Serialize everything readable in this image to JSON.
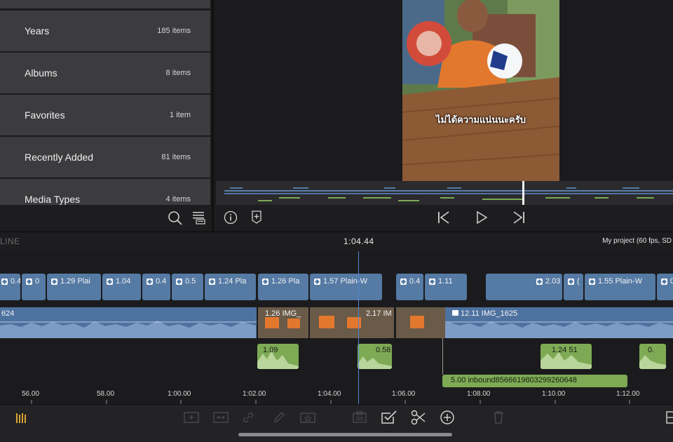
{
  "library": {
    "items": [
      {
        "label": "Years",
        "count": "185 items"
      },
      {
        "label": "Albums",
        "count": "8 items"
      },
      {
        "label": "Favorites",
        "count": "1 item"
      },
      {
        "label": "Recently Added",
        "count": "81 items"
      },
      {
        "label": "Media Types",
        "count": "4 items"
      }
    ]
  },
  "viewer": {
    "subtitle": "ไม่ได้ความแน่นนะครับ"
  },
  "timeline": {
    "mode_label": "LINE",
    "current_time": "1:04.44",
    "project_info": "My project (60 fps, SD",
    "title_clips": [
      {
        "label": "0.4"
      },
      {
        "label": "0"
      },
      {
        "label": "1.29  Plai"
      },
      {
        "label": "1.04"
      },
      {
        "label": "0.4"
      },
      {
        "label": "0.5"
      },
      {
        "label": "1.24  Pla"
      },
      {
        "label": "1.26  Pla"
      },
      {
        "label": "1.57  Plain-W"
      },
      {
        "label": "0.4"
      },
      {
        "label": "1.11"
      },
      {
        "label": "2.03"
      },
      {
        "label": "("
      },
      {
        "label": "1.55  Plain-W"
      },
      {
        "label": "0."
      }
    ],
    "primary_clips": [
      {
        "label": "624"
      },
      {
        "label": "1.26  IMG_"
      },
      {
        "label": "2.17  IM"
      },
      {
        "label": "12.11  IMG_1625"
      }
    ],
    "audio_clips": [
      {
        "label": "1.09"
      },
      {
        "label": "0.58"
      },
      {
        "label": "1.24  51"
      },
      {
        "label": "0."
      },
      {
        "label": "5.00   inbound8566619803299260648"
      }
    ],
    "ruler": [
      "56.00",
      "58.00",
      "1:00.00",
      "1:02.00",
      "1:04.00",
      "1:06.00",
      "1:08.00",
      "1:10.00",
      "1:12.00"
    ]
  },
  "colors": {
    "title_clip": "#557aa4",
    "primary_clip": "#4e72a0",
    "audio_clip": "#7eaa55",
    "playhead": "#4f86d6",
    "panel": "#3c3c3f"
  }
}
